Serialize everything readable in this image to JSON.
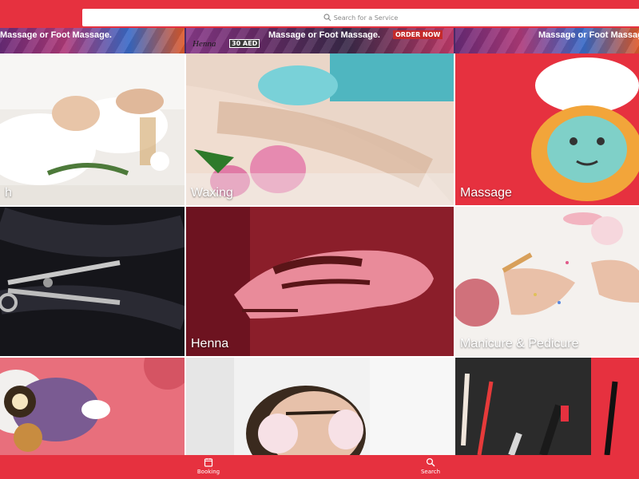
{
  "search": {
    "placeholder": "Search for a Service"
  },
  "banner": {
    "promos": [
      {
        "text": "Massage or Foot Massage."
      },
      {
        "sub": "Henna",
        "price": "30 AED",
        "text": "Massage or Foot Massage.",
        "cta": "ORDER NOW"
      },
      {
        "text": "Massage or Foot Massage."
      }
    ]
  },
  "services": [
    {
      "label": "h"
    },
    {
      "label": "Waxing"
    },
    {
      "label": "Massage"
    },
    {
      "label": ""
    },
    {
      "label": "Henna"
    },
    {
      "label": "Manicure & Pedicure"
    },
    {
      "label": ""
    },
    {
      "label": ""
    },
    {
      "label": ""
    }
  ],
  "nav": {
    "booking": "Booking",
    "search": "Search"
  },
  "colors": {
    "accent": "#e6313f",
    "white": "#ffffff"
  }
}
